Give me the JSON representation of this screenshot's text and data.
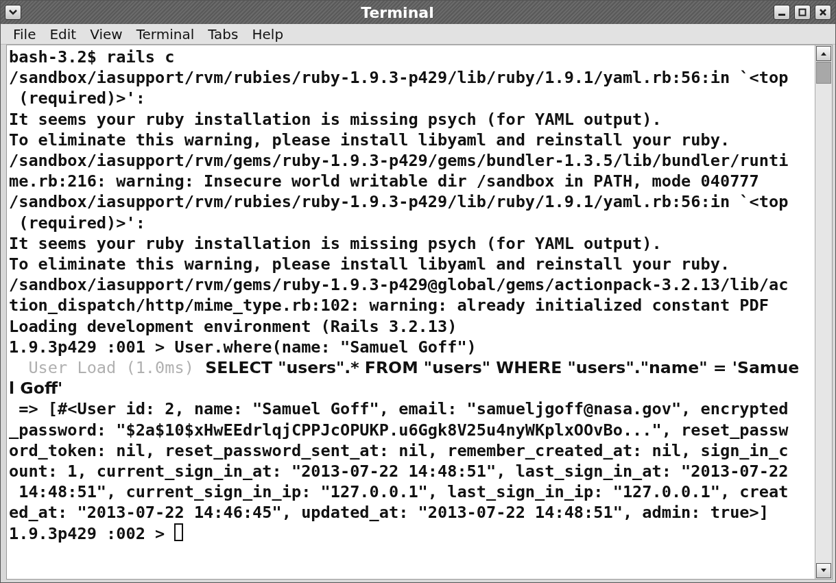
{
  "window": {
    "title": "Terminal"
  },
  "menu": [
    {
      "label": "File"
    },
    {
      "label": "Edit"
    },
    {
      "label": "View"
    },
    {
      "label": "Terminal"
    },
    {
      "label": "Tabs"
    },
    {
      "label": "Help"
    }
  ],
  "terminal": {
    "lines": [
      {
        "kind": "plain",
        "text": "bash-3.2$ rails c"
      },
      {
        "kind": "plain",
        "text": "/sandbox/iasupport/rvm/rubies/ruby-1.9.3-p429/lib/ruby/1.9.1/yaml.rb:56:in `<top"
      },
      {
        "kind": "plain",
        "text": " (required)>':"
      },
      {
        "kind": "plain",
        "text": "It seems your ruby installation is missing psych (for YAML output)."
      },
      {
        "kind": "plain",
        "text": "To eliminate this warning, please install libyaml and reinstall your ruby."
      },
      {
        "kind": "plain",
        "text": "/sandbox/iasupport/rvm/gems/ruby-1.9.3-p429/gems/bundler-1.3.5/lib/bundler/runti"
      },
      {
        "kind": "plain",
        "text": "me.rb:216: warning: Insecure world writable dir /sandbox in PATH, mode 040777"
      },
      {
        "kind": "plain",
        "text": "/sandbox/iasupport/rvm/rubies/ruby-1.9.3-p429/lib/ruby/1.9.1/yaml.rb:56:in `<top"
      },
      {
        "kind": "plain",
        "text": " (required)>':"
      },
      {
        "kind": "plain",
        "text": "It seems your ruby installation is missing psych (for YAML output)."
      },
      {
        "kind": "plain",
        "text": "To eliminate this warning, please install libyaml and reinstall your ruby."
      },
      {
        "kind": "plain",
        "text": "/sandbox/iasupport/rvm/gems/ruby-1.9.3-p429@global/gems/actionpack-3.2.13/lib/ac"
      },
      {
        "kind": "plain",
        "text": "tion_dispatch/http/mime_type.rb:102: warning: already initialized constant PDF"
      },
      {
        "kind": "plain",
        "text": "Loading development environment (Rails 3.2.13)"
      },
      {
        "kind": "plain",
        "text": "1.9.3p429 :001 > User.where(name: \"Samuel Goff\")"
      },
      {
        "kind": "log",
        "label": "  User Load (1.0ms)",
        "sql": "  SELECT \"users\".* FROM \"users\" WHERE \"users\".\"name\" = 'Samue"
      },
      {
        "kind": "sql",
        "text": "l Goff'"
      },
      {
        "kind": "plain",
        "text": " => [#<User id: 2, name: \"Samuel Goff\", email: \"samueljgoff@nasa.gov\", encrypted"
      },
      {
        "kind": "plain",
        "text": "_password: \"$2a$10$xHwEEdrlqjCPPJcOPUKP.u6Ggk8V25u4nyWKplxOOvBo...\", reset_passw"
      },
      {
        "kind": "plain",
        "text": "ord_token: nil, reset_password_sent_at: nil, remember_created_at: nil, sign_in_c"
      },
      {
        "kind": "plain",
        "text": "ount: 1, current_sign_in_at: \"2013-07-22 14:48:51\", last_sign_in_at: \"2013-07-22"
      },
      {
        "kind": "plain",
        "text": " 14:48:51\", current_sign_in_ip: \"127.0.0.1\", last_sign_in_ip: \"127.0.0.1\", creat"
      },
      {
        "kind": "plain",
        "text": "ed_at: \"2013-07-22 14:46:45\", updated_at: \"2013-07-22 14:48:51\", admin: true>]"
      },
      {
        "kind": "prompt",
        "text": "1.9.3p429 :002 > "
      }
    ]
  }
}
